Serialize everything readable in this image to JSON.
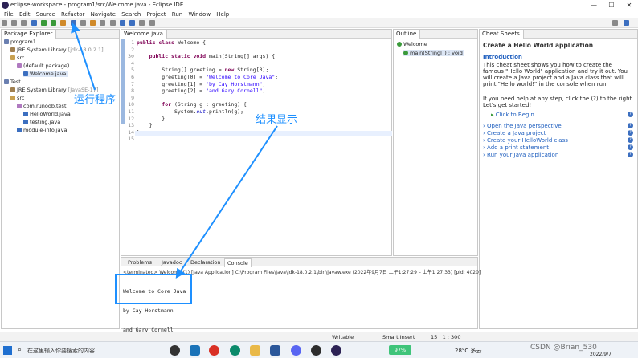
{
  "window": {
    "title": "eclipse-workspace - program1/src/Welcome.java - Eclipse IDE",
    "minimize": "—",
    "maximize": "☐",
    "close": "✕"
  },
  "menu": [
    "File",
    "Edit",
    "Source",
    "Refactor",
    "Navigate",
    "Search",
    "Project",
    "Run",
    "Window",
    "Help"
  ],
  "package_explorer": {
    "tab": "Package Explorer",
    "items": [
      {
        "label": "program1",
        "extra": ""
      },
      {
        "label": "JRE System Library",
        "extra": "[jdk-18.0.2.1]"
      },
      {
        "label": "src",
        "extra": ""
      },
      {
        "label": "(default package)",
        "extra": ""
      },
      {
        "label": "Welcome.java",
        "extra": ""
      },
      {
        "label": "Test",
        "extra": ""
      },
      {
        "label": "JRE System Library",
        "extra": "[JavaSE-17]"
      },
      {
        "label": "src",
        "extra": ""
      },
      {
        "label": "com.runoob.test",
        "extra": ""
      },
      {
        "label": "HelloWorld.java",
        "extra": ""
      },
      {
        "label": "testing.java",
        "extra": ""
      },
      {
        "label": "module-info.java",
        "extra": ""
      }
    ]
  },
  "editor": {
    "tab": "Welcome.java",
    "line_numbers": [
      "1",
      "2",
      "3⊖",
      "4",
      "5",
      "6",
      "7",
      "8",
      "9",
      "10",
      "11",
      "12",
      "13",
      "14",
      "15"
    ],
    "lines": [
      [
        {
          "t": "public class ",
          "c": "kw"
        },
        {
          "t": "Welcome {",
          "c": ""
        }
      ],
      [
        {
          "t": "",
          "c": ""
        }
      ],
      [
        {
          "t": "    ",
          "c": ""
        },
        {
          "t": "public static void ",
          "c": "kw"
        },
        {
          "t": "main(String[] args) {",
          "c": ""
        }
      ],
      [
        {
          "t": "",
          "c": ""
        }
      ],
      [
        {
          "t": "        String[] greeting = ",
          "c": ""
        },
        {
          "t": "new ",
          "c": "kw"
        },
        {
          "t": "String[3];",
          "c": ""
        }
      ],
      [
        {
          "t": "        greeting[0] = ",
          "c": ""
        },
        {
          "t": "\"Welcome to Core Java\"",
          "c": "str"
        },
        {
          "t": ";",
          "c": ""
        }
      ],
      [
        {
          "t": "        greeting[1] = ",
          "c": ""
        },
        {
          "t": "\"by Cay Horstmann\"",
          "c": "str"
        },
        {
          "t": ";",
          "c": ""
        }
      ],
      [
        {
          "t": "        greeting[2] = ",
          "c": ""
        },
        {
          "t": "\"and Gary Cornell\"",
          "c": "str"
        },
        {
          "t": ";",
          "c": ""
        }
      ],
      [
        {
          "t": "",
          "c": ""
        }
      ],
      [
        {
          "t": "        ",
          "c": ""
        },
        {
          "t": "for ",
          "c": "kw"
        },
        {
          "t": "(String g : greeting) {",
          "c": ""
        }
      ],
      [
        {
          "t": "            System.",
          "c": ""
        },
        {
          "t": "out",
          "c": "fld"
        },
        {
          "t": ".println(g);",
          "c": ""
        }
      ],
      [
        {
          "t": "        }",
          "c": ""
        }
      ],
      [
        {
          "t": "    }",
          "c": ""
        }
      ],
      [
        {
          "t": "}",
          "c": ""
        }
      ],
      [
        {
          "t": "",
          "c": ""
        }
      ]
    ]
  },
  "outline": {
    "tab": "Outline",
    "class": "Welcome",
    "method": "main(String[]) : void"
  },
  "cheat": {
    "tab": "Cheat Sheets",
    "title": "Create a Hello World application",
    "intro_heading": "Introduction",
    "intro_text": "This cheat sheet shows you how to create the famous \"Hello World\" application and try it out. You will create a Java project and a Java class that will print \"Hello world!\" in the console when run.",
    "help_text": "If you need help at any step, click the (?) to the right. Let's get started!",
    "click_begin": "Click to Begin",
    "steps": [
      "Open the Java perspective",
      "Create a Java project",
      "Create your HelloWorld class",
      "Add a print statement",
      "Run your Java application"
    ]
  },
  "bottom": {
    "tabs": [
      "Problems",
      "Javadoc",
      "Declaration",
      "Console"
    ],
    "terminated": "<terminated> Welcome (1) [Java Application] C:\\Program Files\\Java\\jdk-18.0.2.1\\bin\\javaw.exe  (2022年9月7日 上午1:27:29 – 上午1:27:33) [pid: 4020]",
    "output": [
      "Welcome to Core Java",
      "by Cay Horstmann",
      "and Gary Cornell"
    ]
  },
  "status": {
    "writable": "Writable",
    "insert": "Smart Insert",
    "position": "15 : 1 : 300"
  },
  "taskbar": {
    "search": "在这里输入你要搜索的内容",
    "battery": "97%",
    "temp": "28°C 多云",
    "time": "2022/9/7",
    "watermark": "CSDN @Brian_530"
  },
  "annotations": {
    "run": "运行程序",
    "result": "结果显示"
  },
  "colors": {
    "accent": "#1e90ff",
    "keyword": "#7f0055",
    "string": "#2a00ff"
  }
}
